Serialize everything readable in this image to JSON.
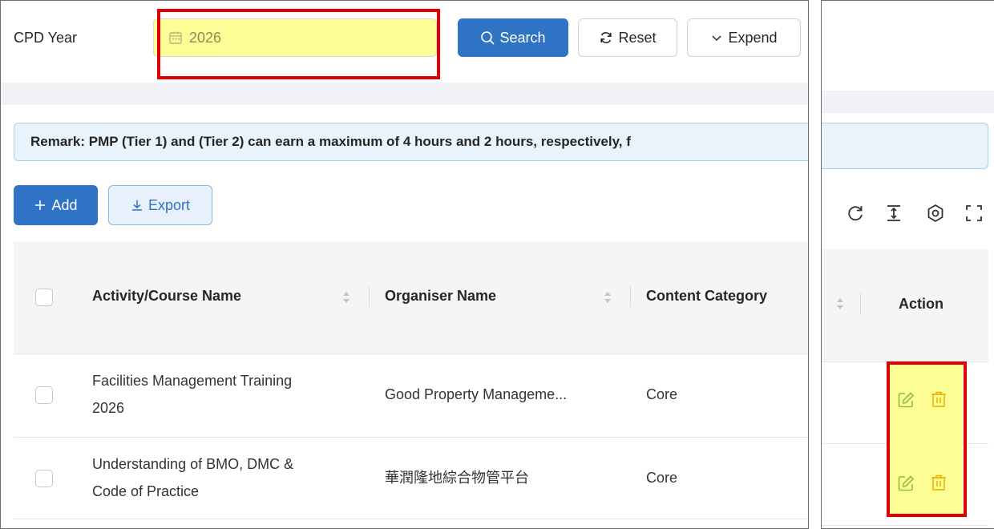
{
  "filter": {
    "label": "CPD Year",
    "year_value": "2026"
  },
  "buttons": {
    "search": "Search",
    "reset": "Reset",
    "expand": "Expend",
    "add": "Add",
    "export": "Export"
  },
  "remark": "Remark: PMP (Tier 1) and (Tier 2) can earn a maximum of 4 hours and 2 hours, respectively, f",
  "table": {
    "columns": [
      "Activity/Course Name",
      "Organiser Name",
      "Content Category",
      "Action"
    ],
    "rows": [
      {
        "course_line1": "Facilities Management Training",
        "course_line2": "2026",
        "organiser": "Good Property Manageme...",
        "category": "Core"
      },
      {
        "course_line1": "Understanding of BMO, DMC &",
        "course_line2": "Code of Practice",
        "organiser": "華潤隆地綜合物管平台",
        "category": "Core"
      }
    ]
  },
  "toolbar_icons": [
    "reload-icon",
    "density-icon",
    "settings-icon",
    "fullscreen-icon"
  ],
  "action_icons": [
    "edit-icon",
    "delete-icon"
  ],
  "colors": {
    "primary": "#2f73c4",
    "highlight_box": "#e00000",
    "highlight_fill": "#fdfd96",
    "action_icon": "#f0b400",
    "edit_icon": "#8fbf3a"
  }
}
